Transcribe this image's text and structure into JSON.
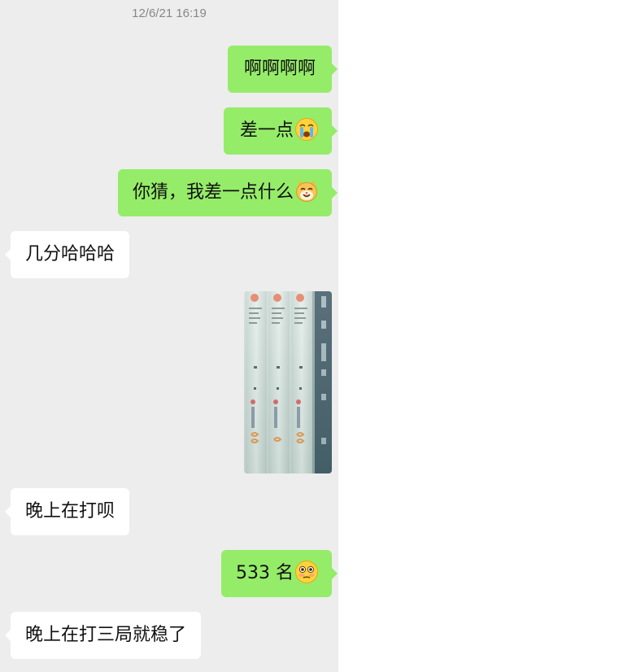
{
  "timestamp": "12/6/21 16:19",
  "messages": [
    {
      "sender": "me",
      "text": "啊啊啊啊",
      "emoji": ""
    },
    {
      "sender": "me",
      "text": "差一点",
      "emoji": "crying-face-emoji"
    },
    {
      "sender": "me",
      "text": "你猜，我差一点什么",
      "emoji": "grinning-cat-emoji"
    },
    {
      "sender": "them",
      "text": "几分哈哈哈",
      "emoji": ""
    },
    {
      "sender": "me",
      "type": "image",
      "description": "photo-of-book-spines",
      "image": "book-spines-photo"
    },
    {
      "sender": "them",
      "text": "晚上在打呗",
      "emoji": ""
    },
    {
      "sender": "me",
      "text": "533 名",
      "emoji": "flushed-face-emoji"
    },
    {
      "sender": "them",
      "text": "晚上在打三局就稳了",
      "emoji": ""
    }
  ],
  "colors": {
    "chat_background": "#ededed",
    "my_bubble": "#95ec69",
    "their_bubble": "#ffffff",
    "timestamp_text": "#888888"
  }
}
